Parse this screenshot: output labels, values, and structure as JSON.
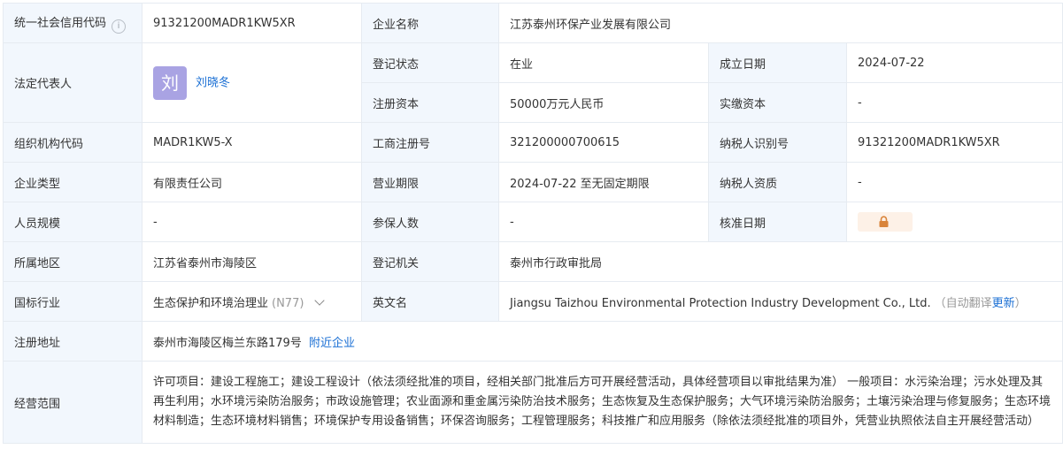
{
  "rows": {
    "credit_code": {
      "label": "统一社会信用代码",
      "value": "91321200MADR1KW5XR"
    },
    "company_name": {
      "label": "企业名称",
      "value": "江苏泰州环保产业发展有限公司"
    },
    "legal_rep": {
      "label": "法定代表人",
      "avatar_char": "刘",
      "name": "刘晓冬"
    },
    "reg_status": {
      "label": "登记状态",
      "value": "在业"
    },
    "est_date": {
      "label": "成立日期",
      "value": "2024-07-22"
    },
    "reg_capital": {
      "label": "注册资本",
      "value": "50000万元人民币"
    },
    "paid_capital": {
      "label": "实缴资本",
      "value": "-"
    },
    "org_code": {
      "label": "组织机构代码",
      "value": "MADR1KW5-X"
    },
    "biz_reg_no": {
      "label": "工商注册号",
      "value": "321200000700615"
    },
    "taxpayer_id": {
      "label": "纳税人识别号",
      "value": "91321200MADR1KW5XR"
    },
    "company_type": {
      "label": "企业类型",
      "value": "有限责任公司"
    },
    "biz_term": {
      "label": "营业期限",
      "value": "2024-07-22 至无固定期限"
    },
    "taxpayer_qual": {
      "label": "纳税人资质",
      "value": "-"
    },
    "staff_size": {
      "label": "人员规模",
      "value": "-"
    },
    "insured_count": {
      "label": "参保人数",
      "value": "-"
    },
    "approval_date": {
      "label": "核准日期",
      "locked": true
    },
    "region": {
      "label": "所属地区",
      "value": "江苏省泰州市海陵区"
    },
    "reg_authority": {
      "label": "登记机关",
      "value": "泰州市行政审批局"
    },
    "industry": {
      "label": "国标行业",
      "value": "生态保护和环境治理业",
      "code": "(N77)"
    },
    "english_name": {
      "label": "英文名",
      "value": "Jiangsu Taizhou Environmental Protection Industry Development Co., Ltd.",
      "note_prefix": "（自动翻译",
      "update_link": "更新",
      "note_suffix": "）"
    },
    "address": {
      "label": "注册地址",
      "value": "泰州市海陵区梅兰东路179号",
      "nearby_link": "附近企业"
    },
    "scope": {
      "label": "经营范围",
      "value": "许可项目：建设工程施工；建设工程设计（依法须经批准的项目，经相关部门批准后方可开展经营活动，具体经营项目以审批结果为准） 一般项目：水污染治理；污水处理及其再生利用；水环境污染防治服务；市政设施管理；农业面源和重金属污染防治技术服务；生态恢复及生态保护服务；大气环境污染防治服务；土壤污染治理与修复服务；生态环境材料制造；生态环境材料销售；环境保护专用设备销售；环保咨询服务；工程管理服务；科技推广和应用服务（除依法须经批准的项目外，凭营业执照依法自主开展经营活动）"
    }
  },
  "icons": {
    "help": "help-circle-icon",
    "lock": "lock-icon",
    "chevron": "chevron-down-icon"
  },
  "colors": {
    "label_bg": "#f2f7fd",
    "link": "#1a6fd4",
    "border": "#e6ebf1",
    "avatar_bg": "#a9a3e3",
    "lock": "#d9843a"
  }
}
